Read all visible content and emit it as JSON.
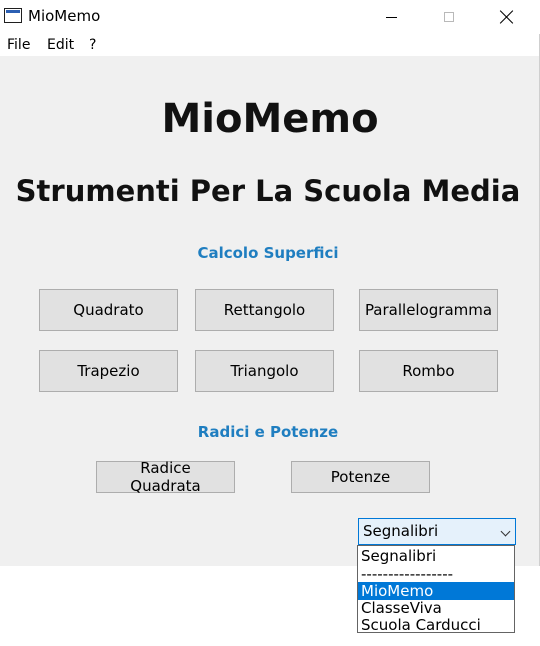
{
  "window": {
    "title": "MioMemo"
  },
  "menubar": {
    "items": [
      "File",
      "Edit",
      "?"
    ]
  },
  "headings": {
    "app_name": "MioMemo",
    "subtitle": "Strumenti Per La Scuola Media"
  },
  "sections": {
    "superfici": {
      "label": "Calcolo Superfici",
      "buttons": [
        "Quadrato",
        "Rettangolo",
        "Parallelogramma",
        "Trapezio",
        "Triangolo",
        "Rombo"
      ]
    },
    "radici": {
      "label": "Radici e Potenze",
      "buttons": [
        "Radice Quadrata",
        "Potenze"
      ]
    }
  },
  "bookmarks": {
    "selected": "Segnalibri",
    "options": [
      "Segnalibri",
      "-----------------",
      "MioMemo",
      "ClasseViva",
      "Scuola Carducci"
    ],
    "highlighted": "MioMemo"
  },
  "colors": {
    "accent": "#1f7ec0",
    "selection": "#0078d7"
  }
}
